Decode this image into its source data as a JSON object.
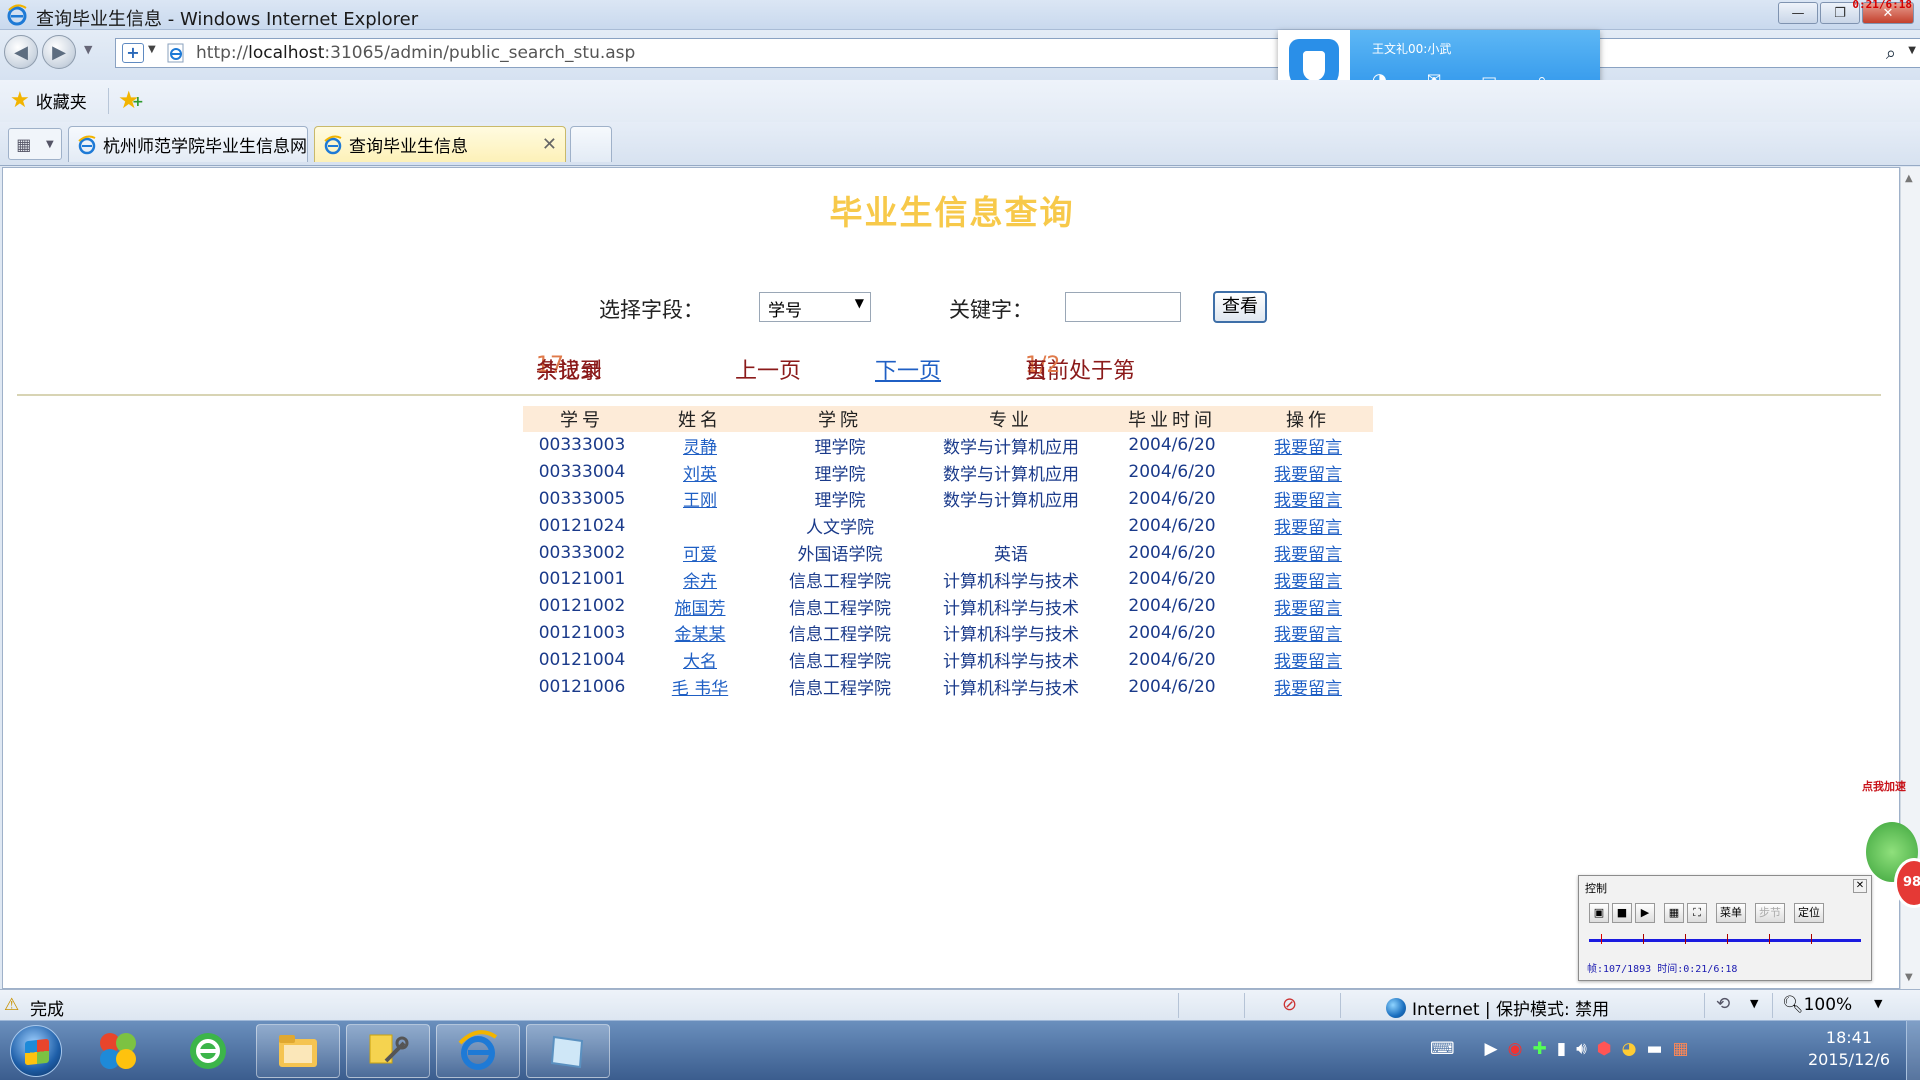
{
  "window": {
    "title": "查询毕业生信息 - Windows Internet Explorer",
    "recorder_time": "0:21/6:18"
  },
  "address_bar": {
    "url_prefix": "http://",
    "url_host": "localhost",
    "url_rest": ":31065/admin/public_search_stu.asp"
  },
  "favorites": {
    "label": "收藏夹"
  },
  "tabs": [
    {
      "label": "杭州师范学院毕业生信息网",
      "active": false
    },
    {
      "label": "查询毕业生信息",
      "active": true
    }
  ],
  "qq_popup": {
    "name": "王文礼00:小武"
  },
  "page": {
    "title": "毕业生信息查询",
    "field_label": "选择字段：",
    "field_value": "学号",
    "keyword_label": "关键字：",
    "keyword_value": "",
    "view_button": "查看",
    "total_prefix": "共找到",
    "total_count": "17",
    "total_suffix": "条记录",
    "prev": "上一页",
    "next": "下一页",
    "current_prefix": "当前处于第",
    "current_page": "1/2",
    "current_suffix": "页"
  },
  "table": {
    "headers": [
      "学号",
      "姓名",
      "学院",
      "专业",
      "毕业时间",
      "操作"
    ],
    "rows": [
      {
        "id": "00333003",
        "name": "灵静",
        "college": "理学院",
        "major": "数学与计算机应用",
        "date": "2004/6/20",
        "action": "我要留言"
      },
      {
        "id": "00333004",
        "name": "刘英",
        "college": "理学院",
        "major": "数学与计算机应用",
        "date": "2004/6/20",
        "action": "我要留言"
      },
      {
        "id": "00333005",
        "name": "王刚",
        "college": "理学院",
        "major": "数学与计算机应用",
        "date": "2004/6/20",
        "action": "我要留言"
      },
      {
        "id": "00121024",
        "name": "",
        "college": "人文学院",
        "major": "",
        "date": "2004/6/20",
        "action": "我要留言"
      },
      {
        "id": "00333002",
        "name": "可爱",
        "college": "外国语学院",
        "major": "英语",
        "date": "2004/6/20",
        "action": "我要留言"
      },
      {
        "id": "00121001",
        "name": "余卉",
        "college": "信息工程学院",
        "major": "计算机科学与技术",
        "date": "2004/6/20",
        "action": "我要留言"
      },
      {
        "id": "00121002",
        "name": "施国芳",
        "college": "信息工程学院",
        "major": "计算机科学与技术",
        "date": "2004/6/20",
        "action": "我要留言"
      },
      {
        "id": "00121003",
        "name": "金某某",
        "college": "信息工程学院",
        "major": "计算机科学与技术",
        "date": "2004/6/20",
        "action": "我要留言"
      },
      {
        "id": "00121004",
        "name": "大名",
        "college": "信息工程学院",
        "major": "计算机科学与技术",
        "date": "2004/6/20",
        "action": "我要留言"
      },
      {
        "id": "00121006",
        "name": "毛 韦华",
        "college": "信息工程学院",
        "major": "计算机科学与技术",
        "date": "2004/6/20",
        "action": "我要留言"
      }
    ]
  },
  "status_bar": {
    "status": "完成",
    "zone": "Internet | 保护模式: 禁用",
    "zoom": "100%"
  },
  "speed_ball": {
    "label": "点我加速",
    "value": "98"
  },
  "control_panel": {
    "title": "控制",
    "menu": "菜单",
    "step": "步节",
    "locate": "定位",
    "frame_info": "帧:107/1893 时间:0:21/6:18"
  },
  "taskbar": {
    "time": "18:41",
    "date": "2015/12/6"
  }
}
